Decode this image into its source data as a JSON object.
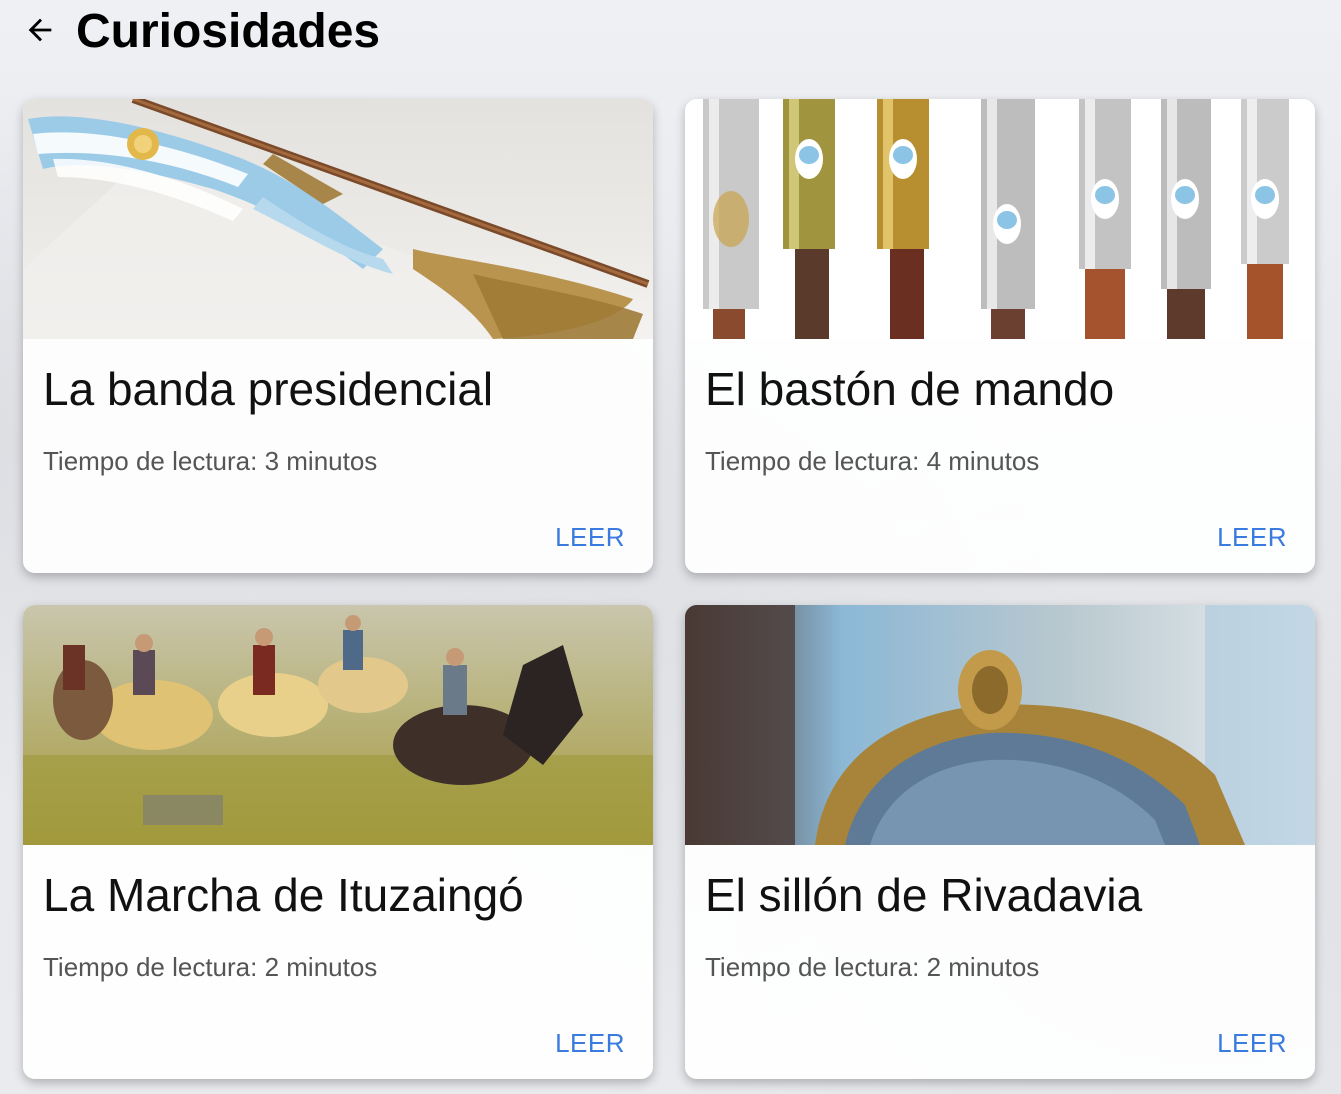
{
  "header": {
    "title": "Curiosidades",
    "back_icon": "arrow-left-icon"
  },
  "colors": {
    "accent": "#3a7be0",
    "title": "#111111",
    "subtitle": "#555555"
  },
  "cards": [
    {
      "title": "La banda presidencial",
      "reading_time": "Tiempo de lectura: 3 minutos",
      "action": "LEER",
      "image": "presidential-sash-image"
    },
    {
      "title": "El bastón de mando",
      "reading_time": "Tiempo de lectura: 4 minutos",
      "action": "LEER",
      "image": "command-staffs-image"
    },
    {
      "title": "La Marcha de Ituzaingó",
      "reading_time": "Tiempo de lectura: 2 minutos",
      "action": "LEER",
      "image": "battle-painting-image"
    },
    {
      "title": "El sillón de Rivadavia",
      "reading_time": "Tiempo de lectura: 2 minutos",
      "action": "LEER",
      "image": "rivadavia-chair-image"
    }
  ]
}
